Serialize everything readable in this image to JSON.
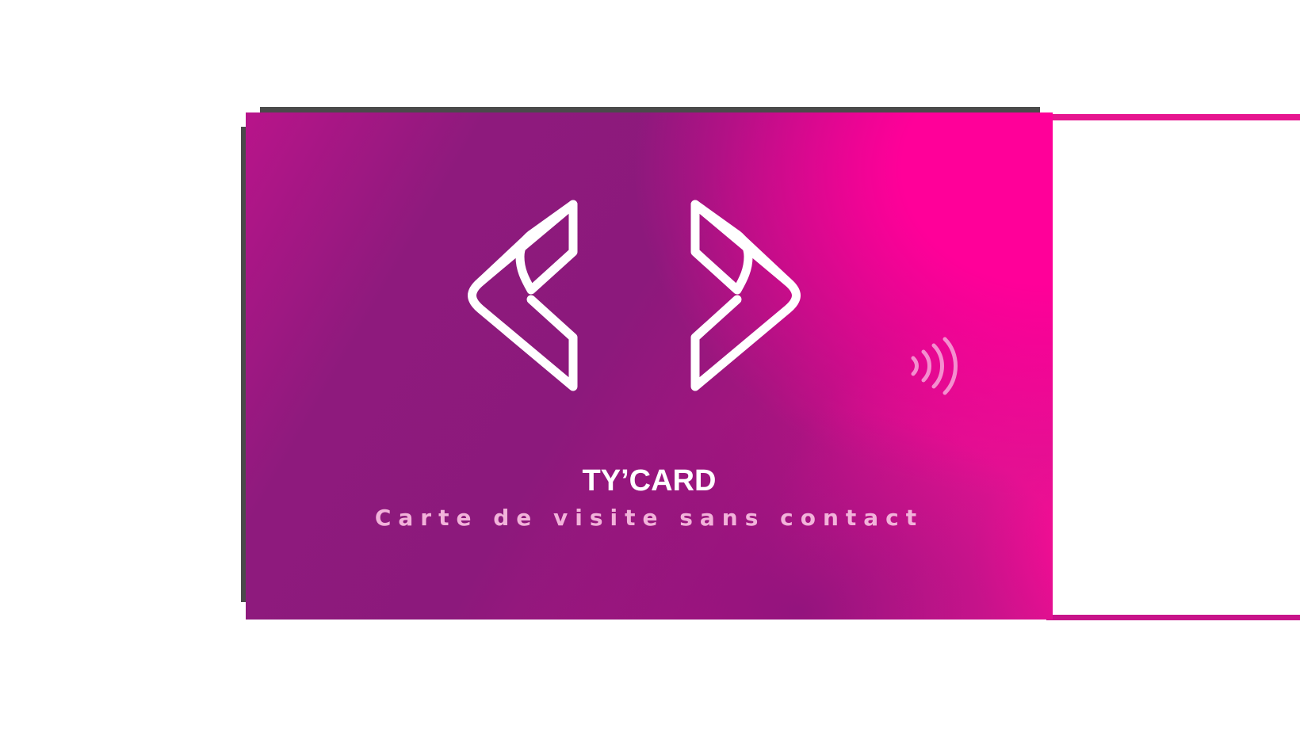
{
  "card": {
    "brand_name": "TY’CARD",
    "tagline": "Carte de visite sans contact"
  },
  "icons": {
    "logo": "angle-brackets-logo-icon",
    "contactless": "contactless-icon"
  },
  "colors": {
    "pink": "#ff0099",
    "purple": "#8c197c",
    "tagline": "#f2b3da",
    "contactless": "#f48fcf"
  }
}
